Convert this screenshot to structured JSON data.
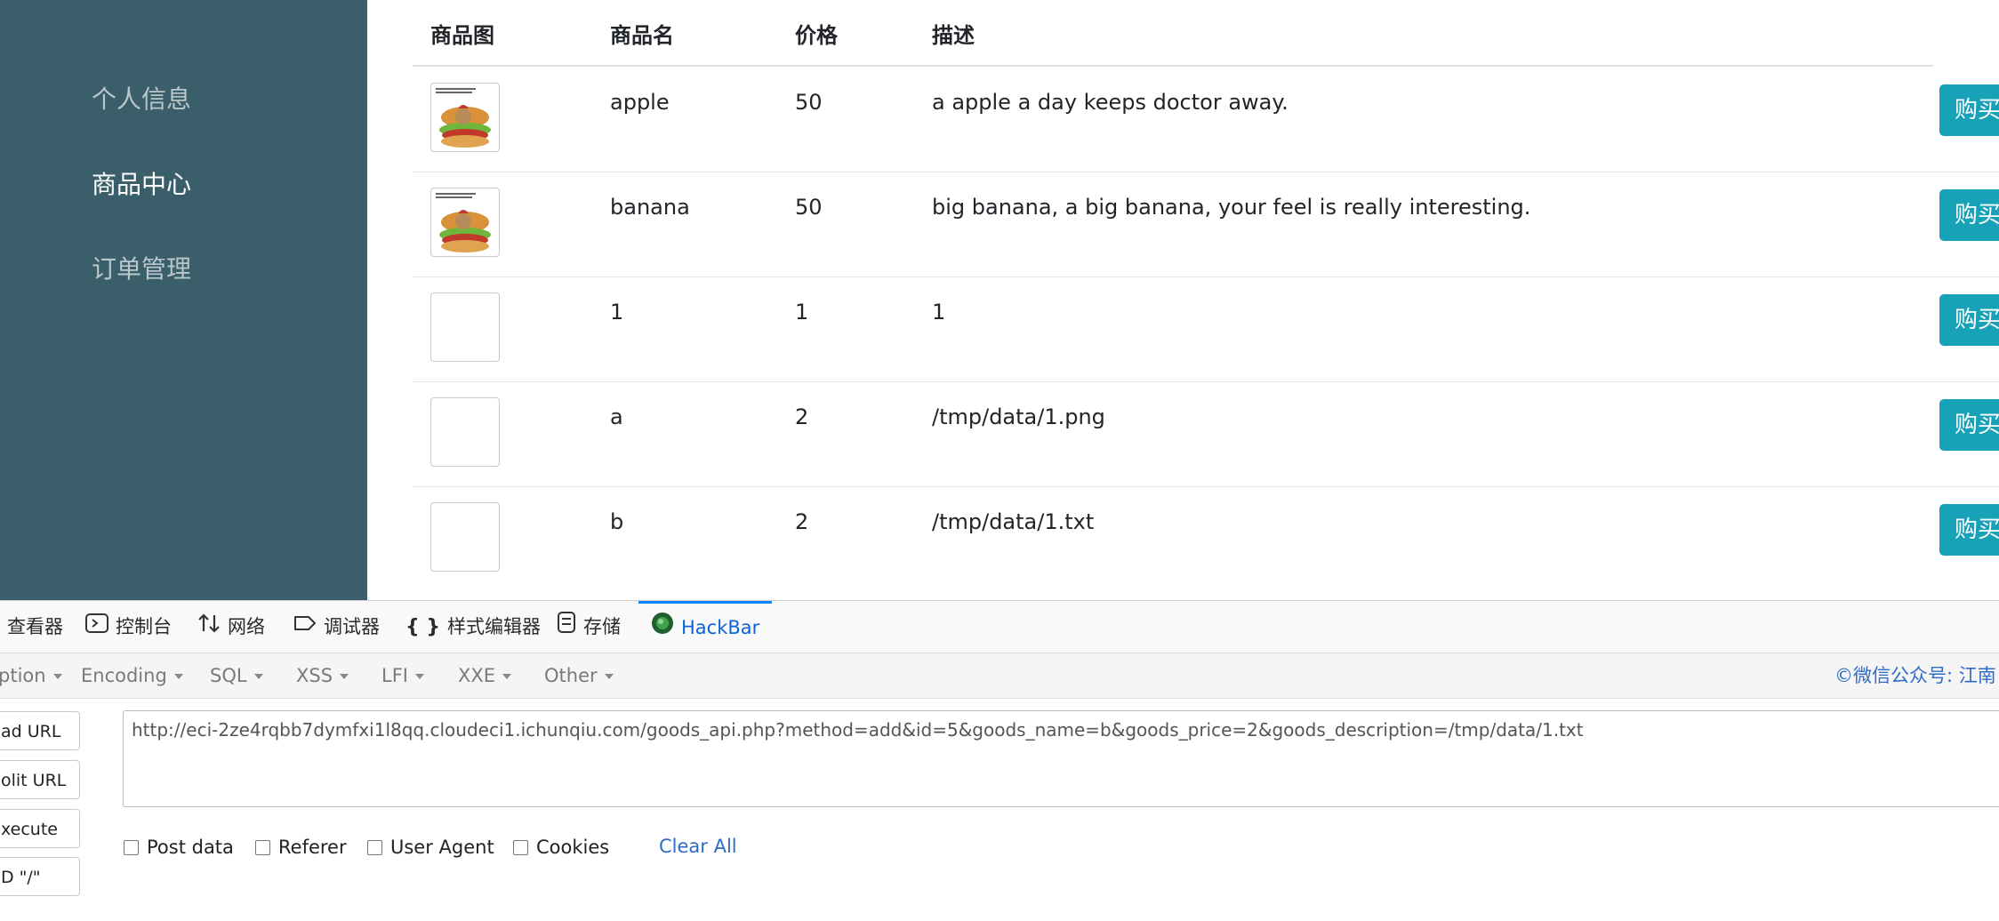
{
  "sidebar": {
    "items": [
      {
        "label": "个人信息",
        "active": false
      },
      {
        "label": "商品中心",
        "active": true
      },
      {
        "label": "订单管理",
        "active": false
      }
    ]
  },
  "table": {
    "headers": {
      "image": "商品图",
      "name": "商品名",
      "price": "价格",
      "description": "描述"
    },
    "buy_label": "购买",
    "rows": [
      {
        "name": "apple",
        "price": "50",
        "description": "a apple a day keeps doctor away.",
        "has_image": true
      },
      {
        "name": "banana",
        "price": "50",
        "description": "big banana, a big banana, your feel is really interesting.",
        "has_image": true
      },
      {
        "name": "1",
        "price": "1",
        "description": "1",
        "has_image": false
      },
      {
        "name": "a",
        "price": "2",
        "description": "/tmp/data/1.png",
        "has_image": false
      },
      {
        "name": "b",
        "price": "2",
        "description": "/tmp/data/1.txt",
        "has_image": false
      }
    ]
  },
  "devtools": {
    "tabs": [
      {
        "label": "查看器",
        "icon": "inspector-icon"
      },
      {
        "label": "控制台",
        "icon": "console-icon"
      },
      {
        "label": "网络",
        "icon": "network-icon"
      },
      {
        "label": "调试器",
        "icon": "debugger-icon"
      },
      {
        "label": "样式编辑器",
        "icon": "style-editor-icon"
      },
      {
        "label": "存储",
        "icon": "storage-icon"
      },
      {
        "label": "HackBar",
        "icon": "hackbar-icon",
        "active": true
      }
    ],
    "hackbar": {
      "menus": [
        "ption",
        "Encoding",
        "SQL",
        "XSS",
        "LFI",
        "XXE",
        "Other"
      ],
      "watermark": "©微信公众号: 江南",
      "side_buttons": [
        "ad URL",
        "olit URL",
        "xecute",
        "D \"/\""
      ],
      "url": "http://eci-2ze4rqbb7dymfxi1l8qq.cloudeci1.ichunqiu.com/goods_api.php?method=add&id=5&goods_name=b&goods_price=2&goods_description=/tmp/data/1.txt",
      "options": [
        "Post data",
        "Referer",
        "User Agent",
        "Cookies"
      ],
      "clear_all": "Clear All"
    }
  },
  "colors": {
    "sidebar_bg": "#3a5f6b",
    "buy_button": "#17a2b8",
    "hackbar_accent": "#0a84ff"
  }
}
